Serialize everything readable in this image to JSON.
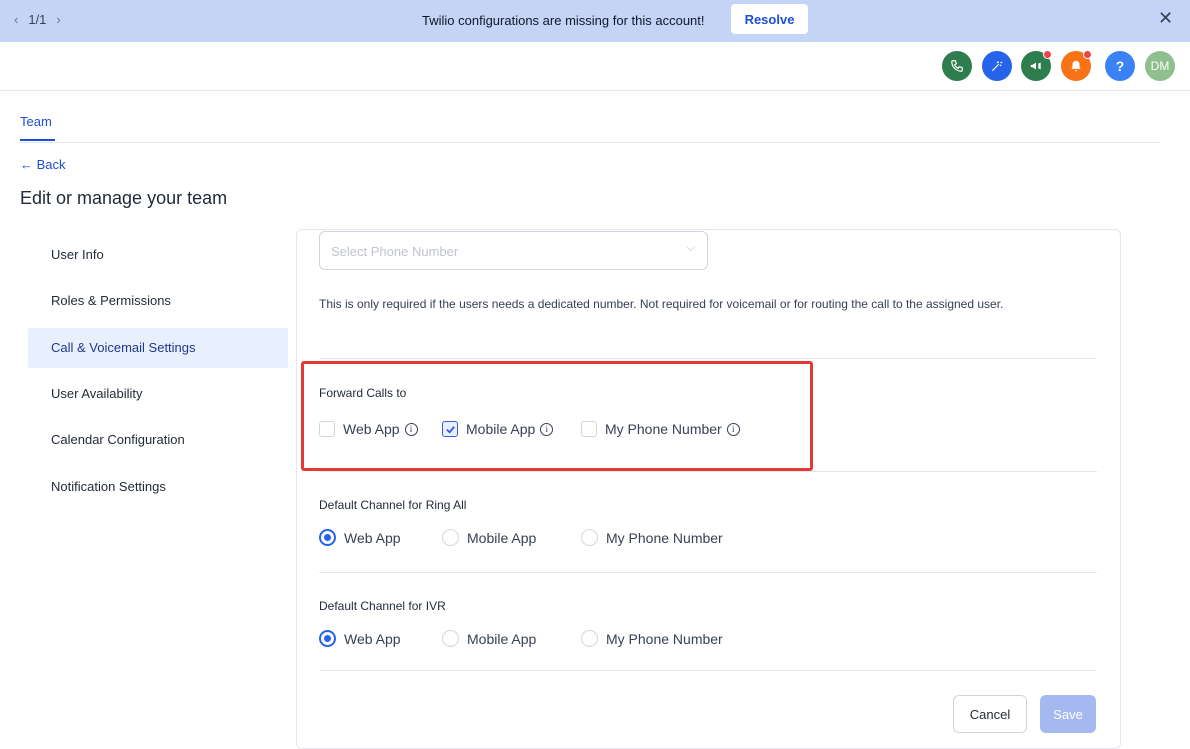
{
  "banner": {
    "pager": "1/1",
    "message": "Twilio configurations are missing for this account!",
    "resolve_label": "Resolve"
  },
  "topbar": {
    "avatar_initials": "DM",
    "help_glyph": "?",
    "icons": [
      "phone-icon",
      "magic-wand-icon",
      "megaphone-icon",
      "bell-icon",
      "help-icon",
      "avatar"
    ],
    "colors": {
      "phone": "#2e7d4f",
      "magic": "#2563eb",
      "megaphone": "#2e7d4f",
      "bell": "#f97316",
      "help": "#3b82f6",
      "avatar": "#8fbf8f"
    }
  },
  "tabs": {
    "team": "Team"
  },
  "back_label": "← Back",
  "page_title": "Edit or manage your team",
  "sidebar": {
    "items": [
      {
        "label": "User Info",
        "active": false
      },
      {
        "label": "Roles & Permissions",
        "active": false
      },
      {
        "label": "Call & Voicemail Settings",
        "active": true
      },
      {
        "label": "User Availability",
        "active": false
      },
      {
        "label": "Calendar Configuration",
        "active": false
      },
      {
        "label": "Notification Settings",
        "active": false
      }
    ]
  },
  "main": {
    "phone_select_placeholder": "Select Phone Number",
    "helper_text": "This is only required if the users needs a dedicated number. Not required for voicemail or for routing the call to the assigned user.",
    "forward": {
      "label": "Forward Calls to",
      "options": [
        {
          "label": "Web App",
          "checked": false
        },
        {
          "label": "Mobile App",
          "checked": true
        },
        {
          "label": "My Phone Number",
          "checked": false
        }
      ]
    },
    "ring_all": {
      "label": "Default Channel for Ring All",
      "options": [
        {
          "label": "Web App",
          "selected": true
        },
        {
          "label": "Mobile App",
          "selected": false
        },
        {
          "label": "My Phone Number",
          "selected": false
        }
      ]
    },
    "ivr": {
      "label": "Default Channel for IVR",
      "options": [
        {
          "label": "Web App",
          "selected": true
        },
        {
          "label": "Mobile App",
          "selected": false
        },
        {
          "label": "My Phone Number",
          "selected": false
        }
      ]
    },
    "cancel_label": "Cancel",
    "save_label": "Save"
  }
}
